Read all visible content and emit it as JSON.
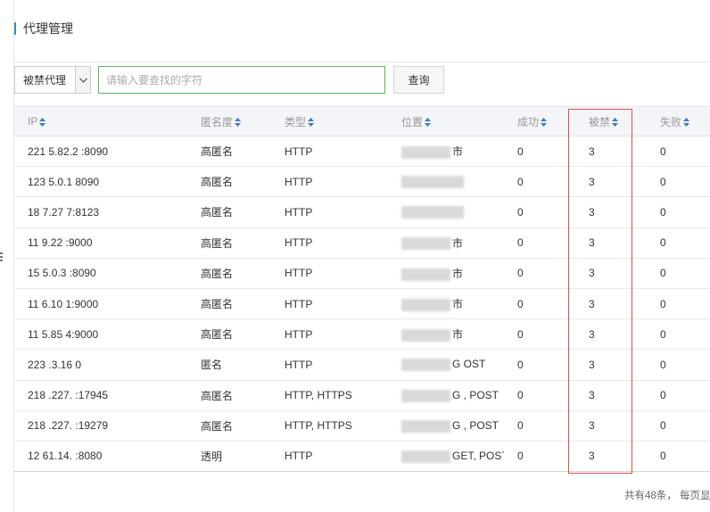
{
  "page": {
    "title": "代理管理"
  },
  "filter": {
    "select_value": "被禁代理",
    "search_placeholder": "请输入要查找的字符",
    "query_label": "查询"
  },
  "table": {
    "columns": [
      {
        "key": "ip",
        "label": "IP",
        "sortable": true
      },
      {
        "key": "anonymity",
        "label": "匿名度",
        "sortable": true
      },
      {
        "key": "type",
        "label": "类型",
        "sortable": true
      },
      {
        "key": "location",
        "label": "位置",
        "sortable": true
      },
      {
        "key": "success",
        "label": "成功",
        "sortable": true
      },
      {
        "key": "banned",
        "label": "被禁",
        "sortable": true
      },
      {
        "key": "failed",
        "label": "失败",
        "sortable": true
      }
    ],
    "rows": [
      {
        "ip": "221 5.82.2 :8090",
        "anonymity": "高匿名",
        "type": "HTTP",
        "location": "市",
        "success": "0",
        "banned": "3",
        "failed": "0"
      },
      {
        "ip": "123 5.0.1 8090",
        "anonymity": "高匿名",
        "type": "HTTP",
        "location": "",
        "success": "0",
        "banned": "3",
        "failed": "0"
      },
      {
        "ip": "18 7.27 7:8123",
        "anonymity": "高匿名",
        "type": "HTTP",
        "location": "",
        "success": "0",
        "banned": "3",
        "failed": "0"
      },
      {
        "ip": "11 9.22 :9000",
        "anonymity": "高匿名",
        "type": "HTTP",
        "location": "市",
        "success": "0",
        "banned": "3",
        "failed": "0"
      },
      {
        "ip": "15 5.0.3 :8090",
        "anonymity": "高匿名",
        "type": "HTTP",
        "location": "市",
        "success": "0",
        "banned": "3",
        "failed": "0"
      },
      {
        "ip": "11 6.10 1:9000",
        "anonymity": "高匿名",
        "type": "HTTP",
        "location": "市",
        "success": "0",
        "banned": "3",
        "failed": "0"
      },
      {
        "ip": "11 5.85 4:9000",
        "anonymity": "高匿名",
        "type": "HTTP",
        "location": "市",
        "success": "0",
        "banned": "3",
        "failed": "0"
      },
      {
        "ip": "223 .3.16 0",
        "anonymity": "匿名",
        "type": "HTTP",
        "location": "G OST",
        "success": "0",
        "banned": "3",
        "failed": "0"
      },
      {
        "ip": "218 .227. :17945",
        "anonymity": "高匿名",
        "type": "HTTP, HTTPS",
        "location": "G , POST",
        "success": "0",
        "banned": "3",
        "failed": "0"
      },
      {
        "ip": "218 .227. :19279",
        "anonymity": "高匿名",
        "type": "HTTP, HTTPS",
        "location": "G , POST",
        "success": "0",
        "banned": "3",
        "failed": "0"
      },
      {
        "ip": "12 61.14. :8080",
        "anonymity": "透明",
        "type": "HTTP",
        "location": "GET, POST",
        "success": "0",
        "banned": "3",
        "failed": "0"
      }
    ]
  },
  "footer": {
    "summary": "共有48条， 每页显"
  },
  "colors": {
    "accent": "#3c8dbc",
    "sort_icon": "#3c7ac9",
    "highlight": "#d9534f",
    "input_focus": "#5cb85c"
  },
  "icons": {
    "sort": "sort-both-arrows-icon",
    "dropdown": "chevron-down-icon"
  }
}
